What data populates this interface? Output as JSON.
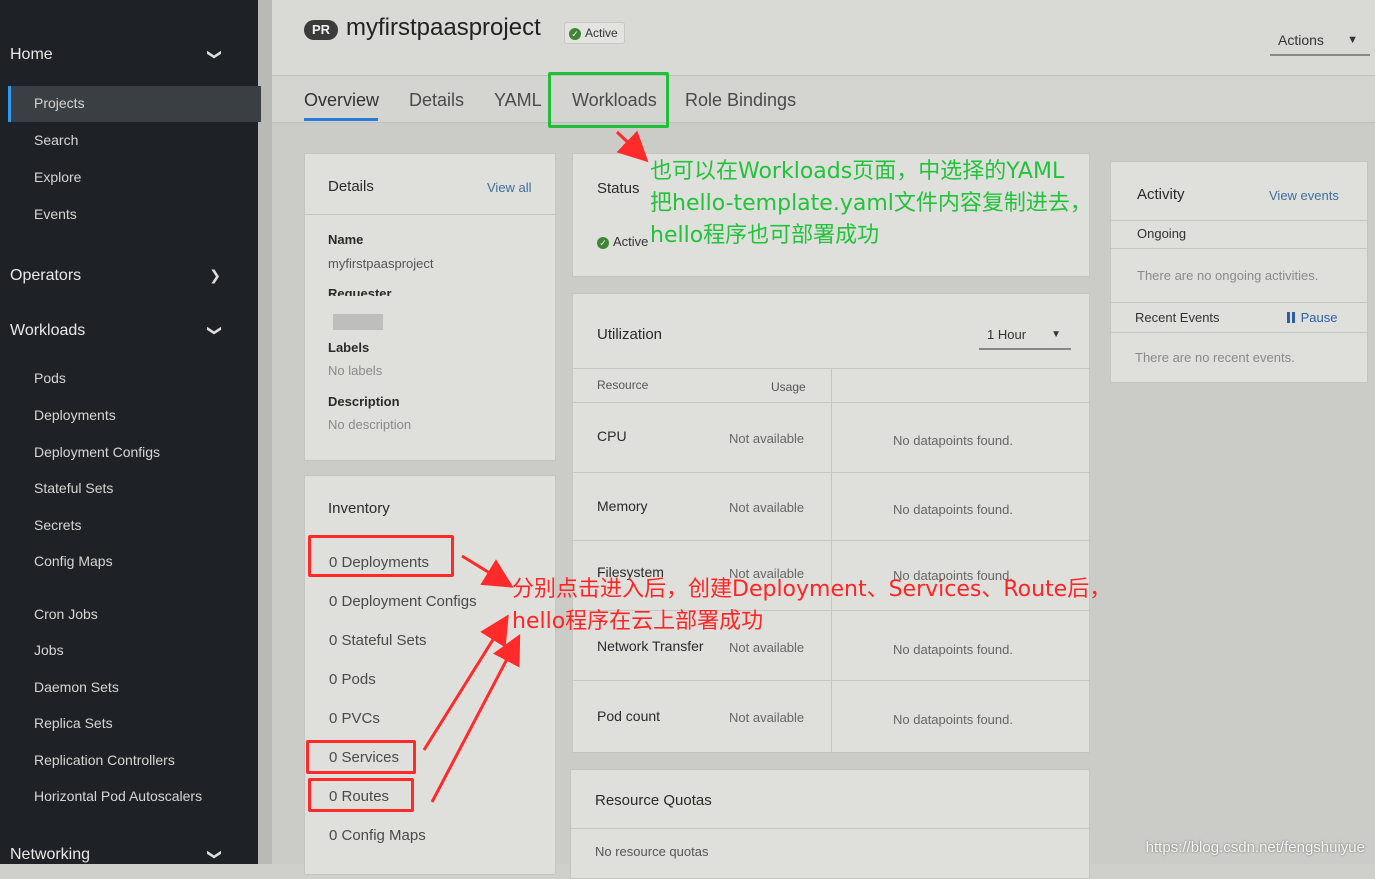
{
  "sidebar": {
    "sections": [
      {
        "label": "Home",
        "chevron": "chevron-down-icon"
      },
      {
        "label": "Operators",
        "chevron": "chevron-right-icon"
      },
      {
        "label": "Workloads",
        "chevron": "chevron-down-icon"
      },
      {
        "label": "Networking",
        "chevron": "chevron-down-icon"
      }
    ],
    "home_items": [
      "Projects",
      "Search",
      "Explore",
      "Events"
    ],
    "workload_items": [
      "Pods",
      "Deployments",
      "Deployment Configs",
      "Stateful Sets",
      "Secrets",
      "Config Maps",
      "Cron Jobs",
      "Jobs",
      "Daemon Sets",
      "Replica Sets",
      "Replication Controllers",
      "Horizontal Pod Autoscalers"
    ],
    "active_item": "Projects"
  },
  "header": {
    "badge": "PR",
    "title": "myfirstpaasproject",
    "status": "Active",
    "actions_label": "Actions"
  },
  "tabs": [
    "Overview",
    "Details",
    "YAML",
    "Workloads",
    "Role Bindings"
  ],
  "details_card": {
    "title": "Details",
    "view_all": "View all",
    "name_label": "Name",
    "name_value": "myfirstpaasproject",
    "requester_label": "Requester",
    "labels_label": "Labels",
    "labels_value": "No labels",
    "description_label": "Description",
    "description_value": "No description"
  },
  "inventory_card": {
    "title": "Inventory",
    "items": [
      "0 Deployments",
      "0 Deployment Configs",
      "0 Stateful Sets",
      "0 Pods",
      "0 PVCs",
      "0 Services",
      "0 Routes",
      "0 Config Maps"
    ]
  },
  "status_card": {
    "title": "Status",
    "value": "Active"
  },
  "utilization_card": {
    "title": "Utilization",
    "range": "1 Hour",
    "col_resource": "Resource",
    "col_usage": "Usage",
    "rows": [
      {
        "label": "CPU",
        "usage": "Not available",
        "chart": "No datapoints found."
      },
      {
        "label": "Memory",
        "usage": "Not available",
        "chart": "No datapoints found."
      },
      {
        "label": "Filesystem",
        "usage": "Not available",
        "chart": "No datapoints found."
      },
      {
        "label": "Network Transfer",
        "usage": "Not available",
        "chart": "No datapoints found."
      },
      {
        "label": "Pod count",
        "usage": "Not available",
        "chart": "No datapoints found."
      }
    ]
  },
  "quotas_card": {
    "title": "Resource Quotas",
    "value": "No resource quotas"
  },
  "activity_card": {
    "title": "Activity",
    "view_events": "View events",
    "ongoing": "Ongoing",
    "ongoing_empty": "There are no ongoing activities.",
    "recent": "Recent Events",
    "pause": "Pause",
    "recent_empty": "There are no recent events."
  },
  "annotations": {
    "green_lines": [
      "也可以在Workloads页面，中选择的YAML",
      "把hello-template.yaml文件内容复制进去，",
      "hello程序也可部署成功"
    ],
    "red_lines": [
      "分别点击进入后，创建Deployment、Services、Route后，",
      "hello程序在云上部署成功"
    ],
    "green": "#22c23a",
    "red": "#ff2525"
  },
  "watermark": "https://blog.csdn.net/fengshuiyue"
}
